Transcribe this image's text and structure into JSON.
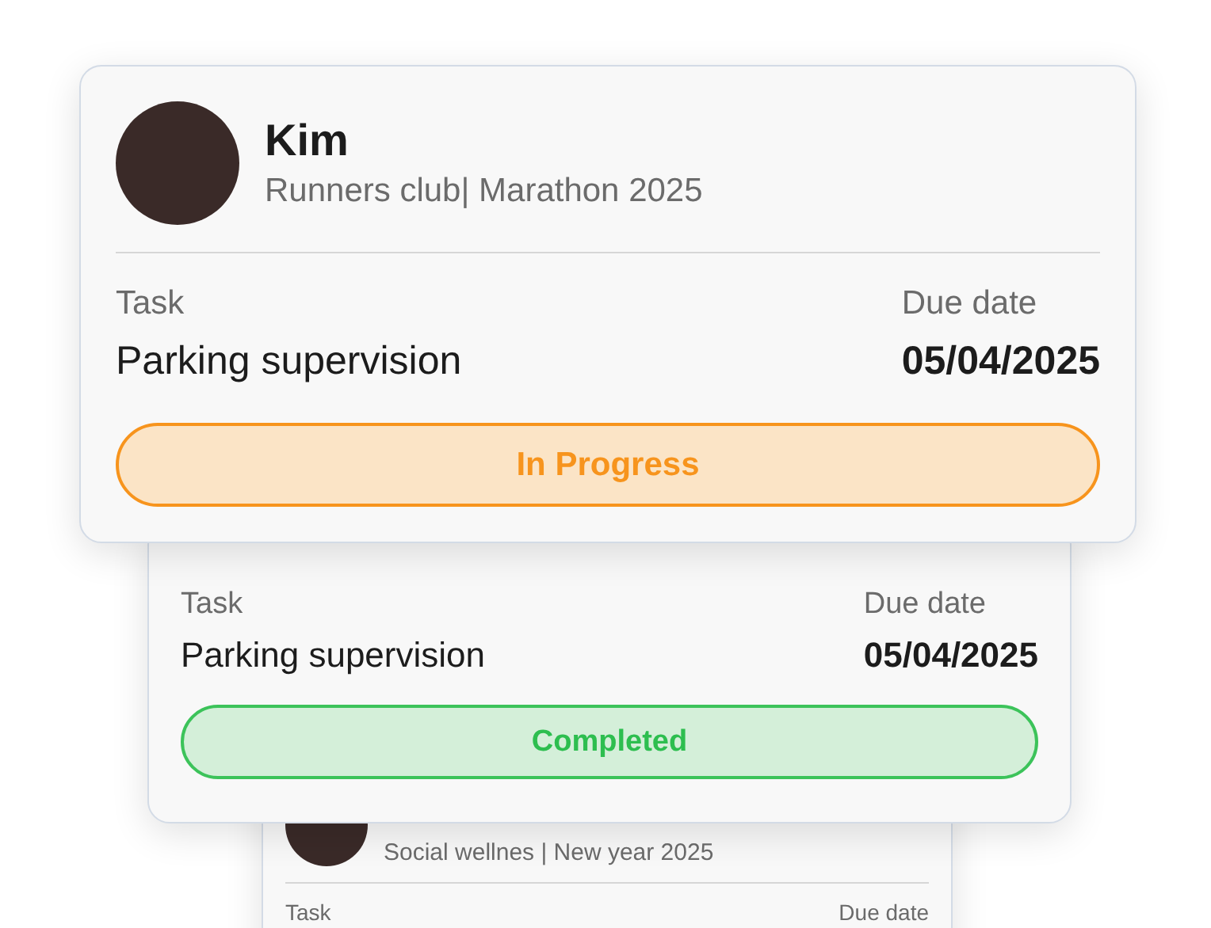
{
  "cards": [
    {
      "name": "Kim",
      "subtitle": "Runners club| Marathon 2025",
      "task_label": "Task",
      "task": "Parking supervision",
      "due_label": "Due date",
      "due": "05/04/2025",
      "status": {
        "label": "In Progress",
        "kind": "in_progress"
      }
    },
    {
      "task_label": "Task",
      "task": "Parking supervision",
      "due_label": "Due date",
      "due": "05/04/2025",
      "status": {
        "label": "Completed",
        "kind": "completed"
      }
    },
    {
      "subtitle": "Social wellnes | New year 2025",
      "task_label": "Task",
      "due_label": "Due date"
    }
  ]
}
